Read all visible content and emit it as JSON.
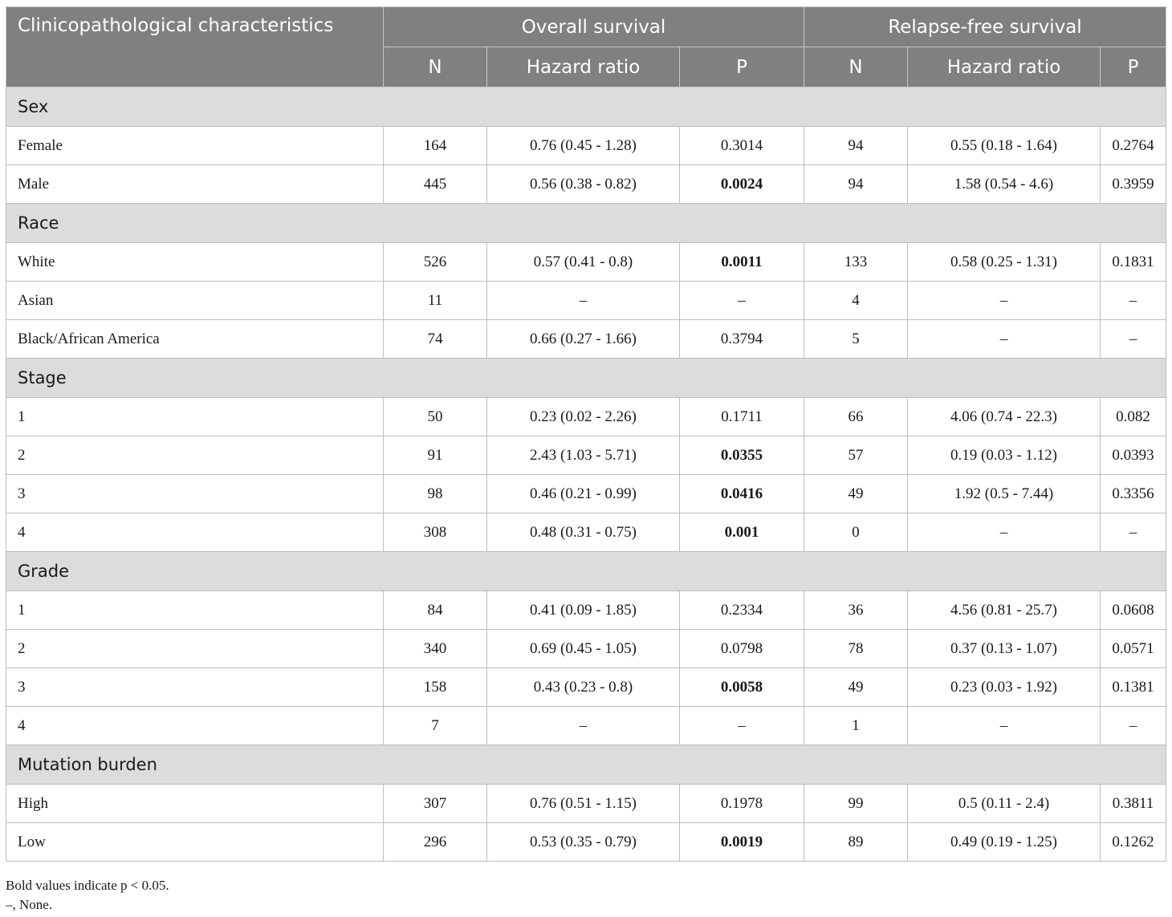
{
  "header": {
    "characteristics": "Clinicopathological characteristics",
    "overall": "Overall survival",
    "relapse": "Relapse-free survival",
    "sub": [
      "N",
      "Hazard ratio",
      "P",
      "N",
      "Hazard ratio",
      "P"
    ]
  },
  "groups": [
    {
      "title": "Sex",
      "rows": [
        {
          "label": "Female",
          "os_n": "164",
          "os_hr": "0.76 (0.45 - 1.28)",
          "os_p": "0.3014",
          "os_sig": false,
          "rfs_n": "94",
          "rfs_hr": "0.55 (0.18 - 1.64)",
          "rfs_p": "0.2764",
          "rfs_sig": false
        },
        {
          "label": "Male",
          "os_n": "445",
          "os_hr": "0.56 (0.38 - 0.82)",
          "os_p": "0.0024",
          "os_sig": true,
          "rfs_n": "94",
          "rfs_hr": "1.58 (0.54 - 4.6)",
          "rfs_p": "0.3959",
          "rfs_sig": false
        }
      ]
    },
    {
      "title": "Race",
      "rows": [
        {
          "label": "White",
          "os_n": "526",
          "os_hr": "0.57 (0.41 - 0.8)",
          "os_p": "0.0011",
          "os_sig": true,
          "rfs_n": "133",
          "rfs_hr": "0.58 (0.25 - 1.31)",
          "rfs_p": "0.1831",
          "rfs_sig": false
        },
        {
          "label": "Asian",
          "os_n": "11",
          "os_hr": "–",
          "os_p": "–",
          "os_sig": false,
          "rfs_n": "4",
          "rfs_hr": "–",
          "rfs_p": "–",
          "rfs_sig": false
        },
        {
          "label": "Black/African America",
          "os_n": "74",
          "os_hr": "0.66 (0.27 - 1.66)",
          "os_p": "0.3794",
          "os_sig": false,
          "rfs_n": "5",
          "rfs_hr": "–",
          "rfs_p": "–",
          "rfs_sig": false
        }
      ]
    },
    {
      "title": "Stage",
      "rows": [
        {
          "label": "1",
          "os_n": "50",
          "os_hr": "0.23 (0.02 - 2.26)",
          "os_p": "0.1711",
          "os_sig": false,
          "rfs_n": "66",
          "rfs_hr": "4.06 (0.74 - 22.3)",
          "rfs_p": "0.082",
          "rfs_sig": false
        },
        {
          "label": "2",
          "os_n": "91",
          "os_hr": "2.43 (1.03 - 5.71)",
          "os_p": "0.0355",
          "os_sig": true,
          "rfs_n": "57",
          "rfs_hr": "0.19 (0.03 - 1.12)",
          "rfs_p": "0.0393",
          "rfs_sig": false
        },
        {
          "label": "3",
          "os_n": "98",
          "os_hr": "0.46 (0.21 - 0.99)",
          "os_p": "0.0416",
          "os_sig": true,
          "rfs_n": "49",
          "rfs_hr": "1.92 (0.5 - 7.44)",
          "rfs_p": "0.3356",
          "rfs_sig": false
        },
        {
          "label": "4",
          "os_n": "308",
          "os_hr": "0.48 (0.31 - 0.75)",
          "os_p": "0.001",
          "os_sig": true,
          "rfs_n": "0",
          "rfs_hr": "–",
          "rfs_p": "–",
          "rfs_sig": false
        }
      ]
    },
    {
      "title": "Grade",
      "rows": [
        {
          "label": "1",
          "os_n": "84",
          "os_hr": "0.41 (0.09 - 1.85)",
          "os_p": "0.2334",
          "os_sig": false,
          "rfs_n": "36",
          "rfs_hr": "4.56 (0.81 - 25.7)",
          "rfs_p": "0.0608",
          "rfs_sig": false
        },
        {
          "label": "2",
          "os_n": "340",
          "os_hr": "0.69 (0.45 - 1.05)",
          "os_p": "0.0798",
          "os_sig": false,
          "rfs_n": "78",
          "rfs_hr": "0.37 (0.13 - 1.07)",
          "rfs_p": "0.0571",
          "rfs_sig": false
        },
        {
          "label": "3",
          "os_n": "158",
          "os_hr": "0.43 (0.23 - 0.8)",
          "os_p": "0.0058",
          "os_sig": true,
          "rfs_n": "49",
          "rfs_hr": "0.23 (0.03 - 1.92)",
          "rfs_p": "0.1381",
          "rfs_sig": false
        },
        {
          "label": "4",
          "os_n": "7",
          "os_hr": "–",
          "os_p": "–",
          "os_sig": false,
          "rfs_n": "1",
          "rfs_hr": "–",
          "rfs_p": "–",
          "rfs_sig": false
        }
      ]
    },
    {
      "title": "Mutation burden",
      "rows": [
        {
          "label": "High",
          "os_n": "307",
          "os_hr": "0.76 (0.51 - 1.15)",
          "os_p": "0.1978",
          "os_sig": false,
          "rfs_n": "99",
          "rfs_hr": "0.5 (0.11 - 2.4)",
          "rfs_p": "0.3811",
          "rfs_sig": false
        },
        {
          "label": "Low",
          "os_n": "296",
          "os_hr": "0.53 (0.35 - 0.79)",
          "os_p": "0.0019",
          "os_sig": true,
          "rfs_n": "89",
          "rfs_hr": "0.49 (0.19 - 1.25)",
          "rfs_p": "0.1262",
          "rfs_sig": false
        }
      ]
    }
  ],
  "footnotes": [
    "Bold values indicate p < 0.05.",
    "–, None."
  ]
}
